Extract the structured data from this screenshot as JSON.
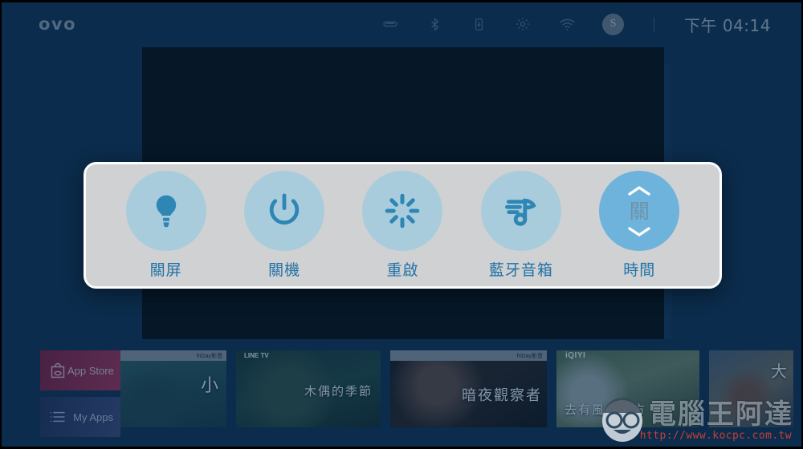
{
  "app": {
    "brand": "ovo",
    "background_color": "#0a2844"
  },
  "statusbar": {
    "logo_text": "ovo",
    "icons": [
      {
        "name": "hdmi-icon",
        "label": "HDMI"
      },
      {
        "name": "bluetooth-icon",
        "label": "Bluetooth"
      },
      {
        "name": "usb-storage-icon",
        "label": "USB Storage"
      },
      {
        "name": "gear-icon",
        "label": "Settings"
      },
      {
        "name": "wifi-icon",
        "label": "Wi-Fi"
      }
    ],
    "avatar_initial": "S",
    "time": "下午 04:14"
  },
  "power_dialog": {
    "items": [
      {
        "id": "screen-off",
        "label": "關屏",
        "icon": "lightbulb-icon",
        "selected": false
      },
      {
        "id": "shutdown",
        "label": "關機",
        "icon": "power-icon",
        "selected": false
      },
      {
        "id": "restart",
        "label": "重啟",
        "icon": "spinner-icon",
        "selected": false
      },
      {
        "id": "bt-speaker",
        "label": "藍牙音箱",
        "icon": "music-note-icon",
        "selected": false
      },
      {
        "id": "timer",
        "label": "時間",
        "icon": "stepper-control",
        "selected": true,
        "value": "關"
      }
    ],
    "accent_color": "#2272a8",
    "circle_color": "#a9ccdd",
    "selected_circle_color": "#6eb3db",
    "panel_color": "#cfd1d2"
  },
  "app_tiles": [
    {
      "id": "app-store",
      "label": "App Store",
      "icon": "shopping-bag-icon",
      "color": "#8b1a3c"
    },
    {
      "id": "my-apps",
      "label": "My Apps",
      "icon": "list-icon",
      "color": "#2b3358"
    }
  ],
  "thumbnails": [
    {
      "id": "thumb-1",
      "provider": "friDay影音",
      "provider_side": "right",
      "title": "小",
      "has_bar": true
    },
    {
      "id": "thumb-2",
      "provider": "LINE TV",
      "provider_side": "left",
      "title": "木偶的季節",
      "has_bar": false
    },
    {
      "id": "thumb-3",
      "provider": "friDay影音",
      "provider_side": "right",
      "title": "暗夜觀察者",
      "has_bar": true
    },
    {
      "id": "thumb-4",
      "provider": "iQIYI",
      "provider_side": "left",
      "title": "去有風的地方",
      "has_bar": false
    },
    {
      "id": "thumb-5",
      "provider": "",
      "provider_side": "left",
      "title": "大",
      "has_bar": false
    }
  ],
  "watermark": {
    "text": "電腦王阿達",
    "url": "http://www.kocpc.com.tw"
  }
}
